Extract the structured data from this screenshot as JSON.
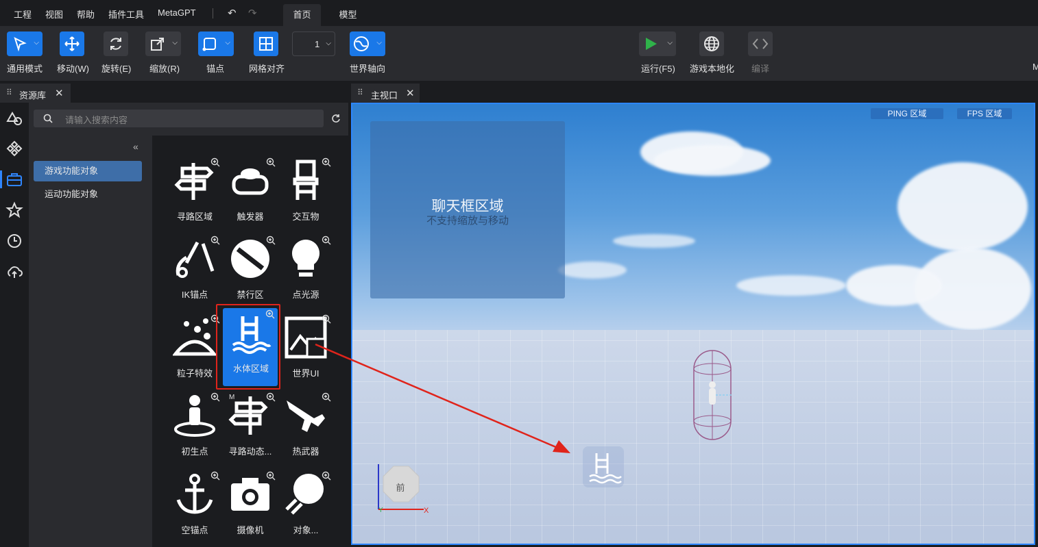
{
  "menubar": {
    "items": [
      "工程",
      "视图",
      "帮助",
      "插件工具",
      "MetaGPT"
    ],
    "tabs": [
      "首页",
      "模型"
    ]
  },
  "toolbar": {
    "general_mode": "通用模式",
    "move": "移动(W)",
    "rotate": "旋转(E)",
    "scale": "缩放(R)",
    "anchor": "锚点",
    "grid_align": "网格对齐",
    "grid_value": "1",
    "world_axis": "世界轴向",
    "run": "运行(F5)",
    "localize": "游戏本地化",
    "compile": "编译",
    "overflow": "M"
  },
  "asset_panel": {
    "tab_title": "资源库",
    "search_placeholder": "请输入搜索内容",
    "categories": [
      "游戏功能对象",
      "运动功能对象"
    ],
    "items": [
      "寻路区域",
      "触发器",
      "交互物",
      "IK锚点",
      "禁行区",
      "点光源",
      "粒子特效",
      "水体区域",
      "世界UI",
      "初生点",
      "寻路动态...",
      "热武器",
      "空锚点",
      "摄像机",
      "对象..."
    ],
    "badge_m": "M"
  },
  "viewport": {
    "tab_title": "主视口",
    "ping_label": "PING 区域",
    "fps_label": "FPS 区域",
    "chat_title": "聊天框区域",
    "chat_subtitle": "不支持缩放与移动",
    "gizmo_label": "前",
    "axis_y": "Y",
    "axis_x": "X"
  },
  "colors": {
    "accent": "#1a78e8",
    "highlight": "#e0241b",
    "run_green": "#2fb24a"
  }
}
